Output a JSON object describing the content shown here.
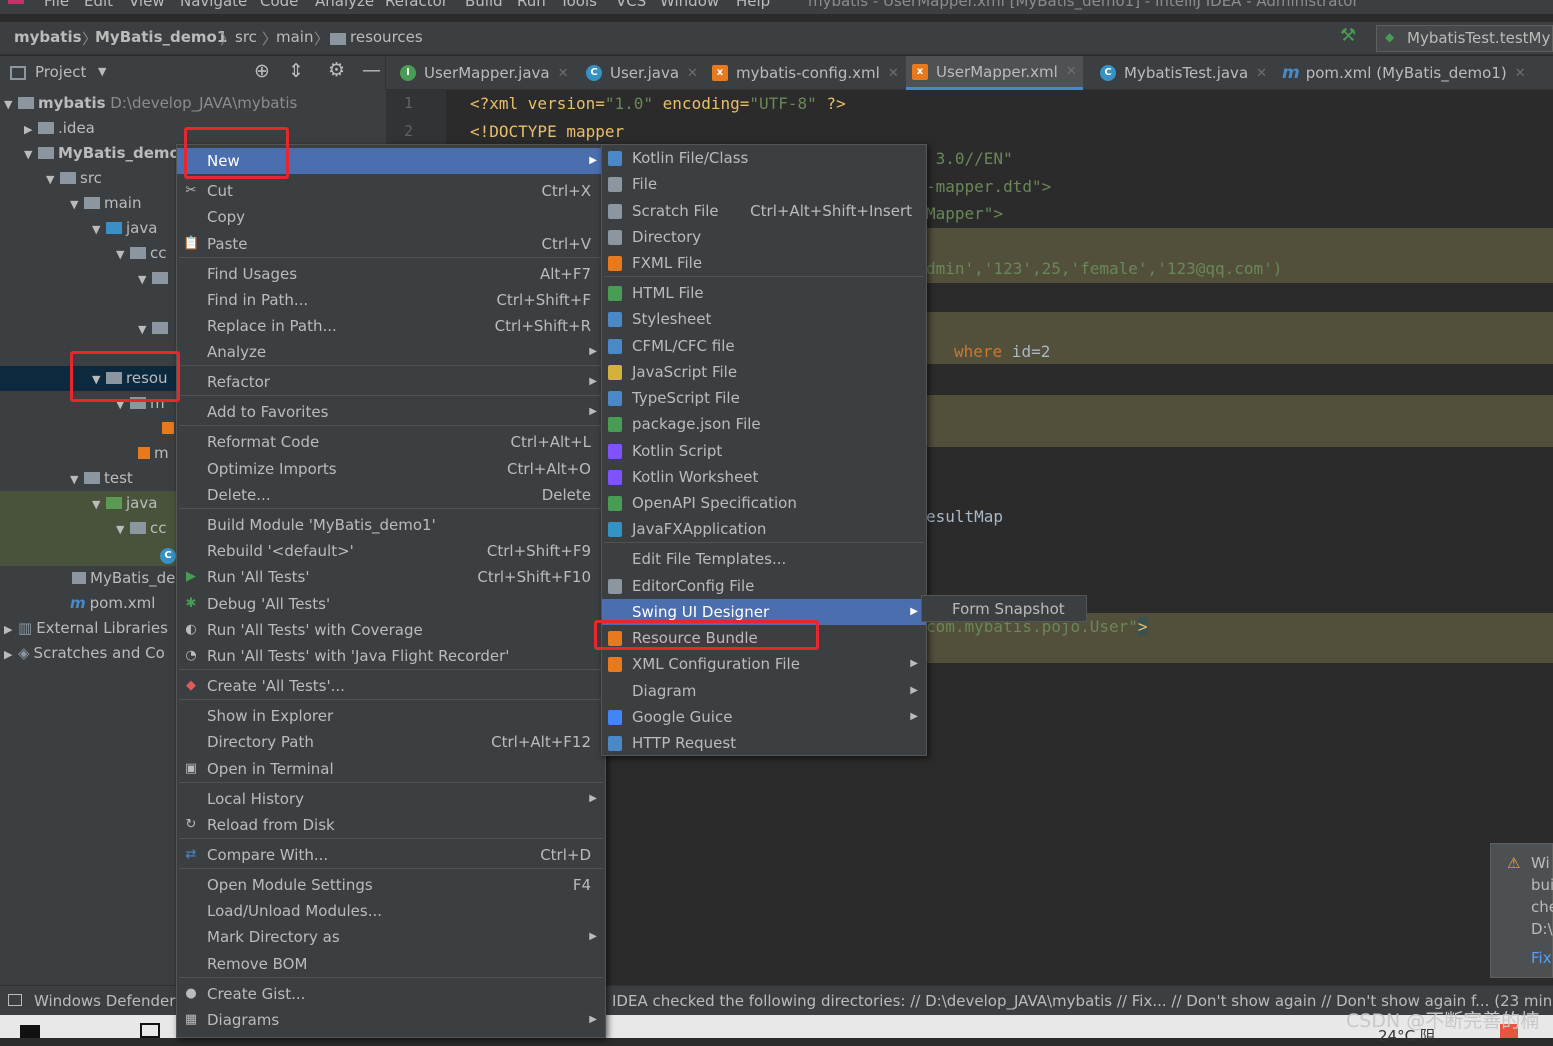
{
  "menubar": {
    "items": [
      "File",
      "Edit",
      "View",
      "Navigate",
      "Code",
      "Analyze",
      "Refactor",
      "Build",
      "Run",
      "Tools",
      "VCS",
      "Window",
      "Help"
    ],
    "title": "mybatis - UserMapper.xml [MyBatis_demo1] - IntelliJ IDEA - Administrator"
  },
  "breadcrumb": {
    "project": "mybatis",
    "module": "MyBatis_demo1",
    "c1": "src",
    "c2": "main",
    "c3": "resources",
    "run_config": "MybatisTest.testMy"
  },
  "project_header": {
    "label": "Project"
  },
  "tabs": [
    {
      "label": "UserMapper.java",
      "icon": "interface-icon",
      "color": "#499c54"
    },
    {
      "label": "User.java",
      "icon": "class-icon",
      "color": "#3592c4"
    },
    {
      "label": "mybatis-config.xml",
      "icon": "xml-icon",
      "color": "#e87a1d"
    },
    {
      "label": "UserMapper.xml",
      "icon": "xml-icon",
      "color": "#e87a1d"
    },
    {
      "label": "MybatisTest.java",
      "icon": "class-icon",
      "color": "#3592c4"
    },
    {
      "label": "pom.xml (MyBatis_demo1)",
      "icon": "maven-icon",
      "color": "#4a88c7"
    }
  ],
  "tree": {
    "root": "mybatis",
    "root_path": "D:\\develop_JAVA\\mybatis",
    "idea": ".idea",
    "module": "MyBatis_demo",
    "src": "src",
    "main": "main",
    "java": "java",
    "cc": "cc",
    "resources": "resou",
    "m1": "m",
    "m2": "m",
    "test": "test",
    "java2": "java",
    "cc2": "cc",
    "iml": "MyBatis_de",
    "pom": "pom.xml",
    "ext": "External Libraries",
    "scratch": "Scratches and Co"
  },
  "gutter": {
    "l1": "1",
    "l2": "2"
  },
  "code": {
    "l1a": "<?xml version=",
    "l1b": "\"1.0\"",
    "l1c": " encoding=",
    "l1d": "\"UTF-8\"",
    "l1e": " ?>",
    "l2": "<!DOCTYPE mapper",
    "l3": " 3.0//EN\"",
    "l4": "-mapper.dtd\">",
    "l5": "Mapper\">",
    "l6": "dmin','123',25,'female','123@qq.com')",
    "l7a": "where",
    "l7b": " id=2",
    "l8": "esultMap",
    "l9a": "com.mybatis.pojo.User\"",
    "l9b": ">"
  },
  "context_menu": [
    {
      "label": "New",
      "shortcut": "",
      "submenu": true,
      "icon": ""
    },
    {
      "label": "Cut",
      "shortcut": "Ctrl+X",
      "icon": "✂"
    },
    {
      "label": "Copy",
      "shortcut": "",
      "icon": ""
    },
    {
      "label": "Paste",
      "shortcut": "Ctrl+V",
      "icon": "📋"
    },
    {
      "label": "Find Usages",
      "shortcut": "Alt+F7"
    },
    {
      "label": "Find in Path...",
      "shortcut": "Ctrl+Shift+F"
    },
    {
      "label": "Replace in Path...",
      "shortcut": "Ctrl+Shift+R"
    },
    {
      "label": "Analyze",
      "shortcut": "",
      "submenu": true
    },
    {
      "label": "Refactor",
      "shortcut": "",
      "submenu": true
    },
    {
      "label": "Add to Favorites",
      "shortcut": "",
      "submenu": true
    },
    {
      "label": "Reformat Code",
      "shortcut": "Ctrl+Alt+L"
    },
    {
      "label": "Optimize Imports",
      "shortcut": "Ctrl+Alt+O"
    },
    {
      "label": "Delete...",
      "shortcut": "Delete"
    },
    {
      "label": "Build Module 'MyBatis_demo1'",
      "shortcut": ""
    },
    {
      "label": "Rebuild '<default>'",
      "shortcut": "Ctrl+Shift+F9"
    },
    {
      "label": "Run 'All Tests'",
      "shortcut": "Ctrl+Shift+F10",
      "icon": "▶"
    },
    {
      "label": "Debug 'All Tests'",
      "shortcut": "",
      "icon": "✱"
    },
    {
      "label": "Run 'All Tests' with Coverage",
      "shortcut": "",
      "icon": "◐"
    },
    {
      "label": "Run 'All Tests' with 'Java Flight Recorder'",
      "shortcut": "",
      "icon": "◔"
    },
    {
      "label": "Create 'All Tests'...",
      "shortcut": "",
      "icon": "◆"
    },
    {
      "label": "Show in Explorer",
      "shortcut": ""
    },
    {
      "label": "Directory Path",
      "shortcut": "Ctrl+Alt+F12"
    },
    {
      "label": "Open in Terminal",
      "shortcut": "",
      "icon": "▣"
    },
    {
      "label": "Local History",
      "shortcut": "",
      "submenu": true
    },
    {
      "label": "Reload from Disk",
      "shortcut": "",
      "icon": "↻"
    },
    {
      "label": "Compare With...",
      "shortcut": "Ctrl+D",
      "icon": "⇄"
    },
    {
      "label": "Open Module Settings",
      "shortcut": "F4"
    },
    {
      "label": "Load/Unload Modules...",
      "shortcut": ""
    },
    {
      "label": "Mark Directory as",
      "shortcut": "",
      "submenu": true
    },
    {
      "label": "Remove BOM",
      "shortcut": ""
    },
    {
      "label": "Create Gist...",
      "shortcut": "",
      "icon": "●"
    },
    {
      "label": "Diagrams",
      "shortcut": "",
      "submenu": true,
      "icon": "▦"
    }
  ],
  "new_submenu": [
    {
      "label": "Kotlin File/Class",
      "shortcut": ""
    },
    {
      "label": "File",
      "shortcut": ""
    },
    {
      "label": "Scratch File",
      "shortcut": "Ctrl+Alt+Shift+Insert"
    },
    {
      "label": "Directory",
      "shortcut": ""
    },
    {
      "label": "FXML File",
      "shortcut": ""
    },
    {
      "label": "HTML File",
      "shortcut": ""
    },
    {
      "label": "Stylesheet",
      "shortcut": ""
    },
    {
      "label": "CFML/CFC file",
      "shortcut": ""
    },
    {
      "label": "JavaScript File",
      "shortcut": ""
    },
    {
      "label": "TypeScript File",
      "shortcut": ""
    },
    {
      "label": "package.json File",
      "shortcut": ""
    },
    {
      "label": "Kotlin Script",
      "shortcut": ""
    },
    {
      "label": "Kotlin Worksheet",
      "shortcut": ""
    },
    {
      "label": "OpenAPI Specification",
      "shortcut": ""
    },
    {
      "label": "JavaFXApplication",
      "shortcut": ""
    },
    {
      "label": "Edit File Templates...",
      "shortcut": ""
    },
    {
      "label": "EditorConfig File",
      "shortcut": ""
    },
    {
      "label": "Swing UI Designer",
      "shortcut": "",
      "submenu": true
    },
    {
      "label": "Resource Bundle",
      "shortcut": ""
    },
    {
      "label": "XML Configuration File",
      "shortcut": "",
      "submenu": true
    },
    {
      "label": "Diagram",
      "shortcut": "",
      "submenu": true
    },
    {
      "label": "Google Guice",
      "shortcut": "",
      "submenu": true
    },
    {
      "label": "HTTP Request",
      "shortcut": ""
    }
  ],
  "swing_submenu": {
    "label": "Form Snapshot"
  },
  "status": {
    "left": "Windows Defender",
    "message": "IDEA checked the following directories: // D:\\develop_JAVA\\mybatis // Fix... // Don't show again // Don't show again f... (23 minute"
  },
  "notification": {
    "l1": "Wi",
    "l2": "bui",
    "l3": "che",
    "l4": "D:\\",
    "link": "Fix"
  },
  "watermark": "CSDN @不断完善的楠",
  "taskbar": {
    "temp": "24°C 阴"
  },
  "colors": {
    "accent": "#4b6eaf",
    "highlight": "#e8262d"
  }
}
